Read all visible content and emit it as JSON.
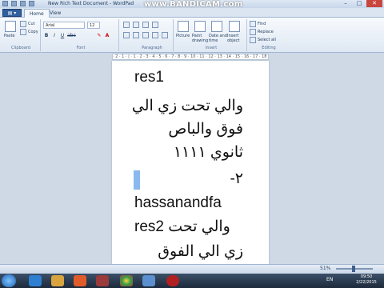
{
  "window": {
    "title": "New Rich Text Document - WordPad",
    "minimize": "–",
    "maximize": "□",
    "close": "✕"
  },
  "watermark": "www.BANDICAM.com",
  "tabs": [
    {
      "label": "Home"
    },
    {
      "label": "View"
    }
  ],
  "ribbon": {
    "clipboard": {
      "paste": "Paste",
      "cut": "Cut",
      "copy": "Copy",
      "label": "Clipboard"
    },
    "font": {
      "family": "Arial",
      "size": "12",
      "label": "Font"
    },
    "paragraph": {
      "label": "Paragraph"
    },
    "insert": {
      "picture": "Picture",
      "paint": "Paint drawing",
      "datetime": "Date and time",
      "object": "Insert object",
      "label": "Insert"
    },
    "editing": {
      "find": "Find",
      "replace": "Replace",
      "select_all": "Select all",
      "label": "Editing"
    }
  },
  "ruler": "· 2 · 1 · | · 1 · 2 · 3 · 4 · 5 · 6 · 7 · 8 · 9 · 10 · 11 · 12 · 13 · 14 · 15 · 16 · 17 · 18",
  "document": {
    "lines": [
      {
        "text": "res1",
        "dir": "ltr"
      },
      {
        "text": "والي تحت زي الي",
        "dir": "rtl"
      },
      {
        "text": "فوق والباص",
        "dir": "rtl"
      },
      {
        "text": "ثانوي ١١١١",
        "dir": "rtl"
      },
      {
        "text": "٢-",
        "dir": "rtl"
      },
      {
        "text": "hassanandfa",
        "dir": "ltr"
      },
      {
        "text": "res2  والي تحت",
        "dir": "ltr"
      },
      {
        "text": "زي الي الفوق",
        "dir": "rtl"
      }
    ]
  },
  "status": {
    "zoom": "51%"
  },
  "taskbar": {
    "lang": "EN",
    "time": "09:50",
    "date": "2/22/2015"
  }
}
